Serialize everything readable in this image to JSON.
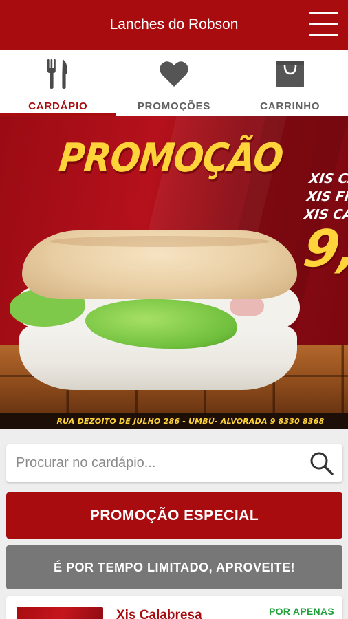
{
  "header": {
    "title": "Lanches do Robson"
  },
  "tabs": [
    {
      "label": "CARDÁPIO",
      "icon": "fork-knife-icon",
      "active": true
    },
    {
      "label": "PROMOÇÕES",
      "icon": "heart-icon",
      "active": false
    },
    {
      "label": "CARRINHO",
      "icon": "shopping-bag-icon",
      "active": false
    }
  ],
  "banner": {
    "title": "PROMOÇÃO",
    "items": [
      "XIS CAR",
      "XIS FRAI",
      "XIS CALA"
    ],
    "price": "9,",
    "address": "RUA DEZOITO DE JULHO 286 - UMBÚ- ALVORADA 9 8330 8368"
  },
  "search": {
    "placeholder": "Procurar no cardápio..."
  },
  "promo": {
    "special_label": "PROMOÇÃO ESPECIAL",
    "limited_label": "É POR TEMPO LIMITADO, APROVEITE!"
  },
  "product": {
    "name": "Xis Calabresa",
    "price_label": "POR APENAS"
  },
  "colors": {
    "brand": "#a80c0f",
    "accent_yellow": "#ffd43b",
    "gray_button": "#777777",
    "price_green": "#21a03c"
  }
}
